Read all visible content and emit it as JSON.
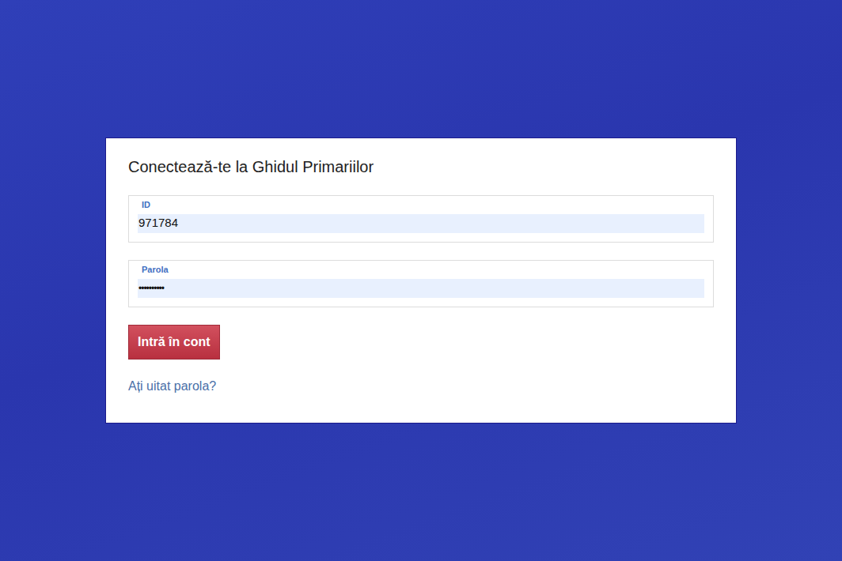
{
  "page": {
    "title": "Conectează-te la Ghidul Primariilor"
  },
  "fields": [
    {
      "label": "ID",
      "value": "971784",
      "kind": "text"
    },
    {
      "label": "Parola",
      "value": "••••••••••",
      "kind": "password"
    }
  ],
  "submit_button": "Intră în cont",
  "forgot_link": "Ați uitat parola?"
}
